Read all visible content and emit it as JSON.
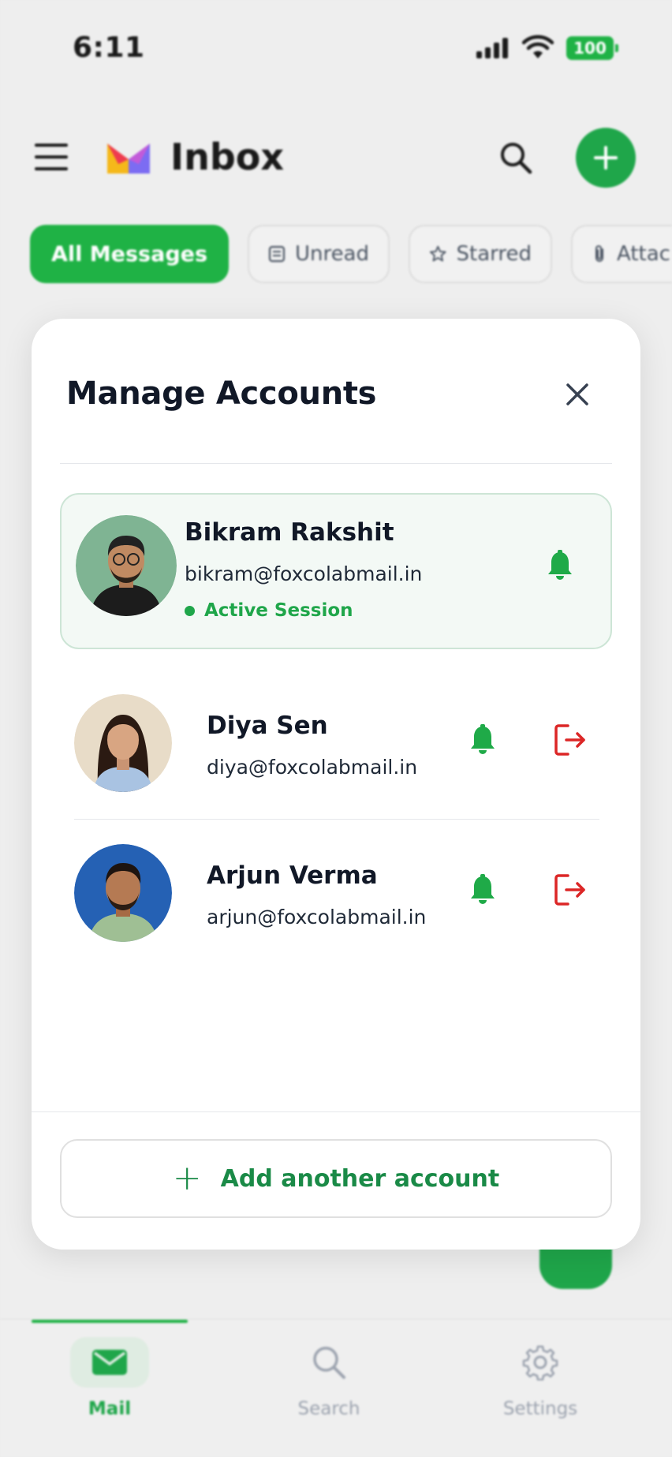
{
  "status_bar": {
    "time": "6:11",
    "battery": "100"
  },
  "header": {
    "title": "Inbox"
  },
  "filters": [
    {
      "label": "All Messages",
      "active": true
    },
    {
      "label": "Unread",
      "icon": "inbox-icon"
    },
    {
      "label": "Starred",
      "icon": "star-icon"
    },
    {
      "label": "Attac",
      "icon": "paperclip-icon"
    }
  ],
  "modal": {
    "title": "Manage Accounts",
    "accounts": [
      {
        "name": "Bikram Rakshit",
        "email": "bikram@foxcolabmail.in",
        "status": "Active Session",
        "active": true
      },
      {
        "name": "Diya Sen",
        "email": "diya@foxcolabmail.in"
      },
      {
        "name": "Arjun Verma",
        "email": "arjun@foxcolabmail.in"
      }
    ],
    "add_label": "Add another account",
    "add_icon": "+"
  },
  "nav": [
    {
      "label": "Mail",
      "icon": "mail-icon",
      "active": true
    },
    {
      "label": "Search",
      "icon": "search-icon"
    },
    {
      "label": "Settings",
      "icon": "gear-icon"
    }
  ],
  "colors": {
    "accent": "#1fb245",
    "danger": "#dc2626",
    "active_bg": "#f3f9f5"
  }
}
